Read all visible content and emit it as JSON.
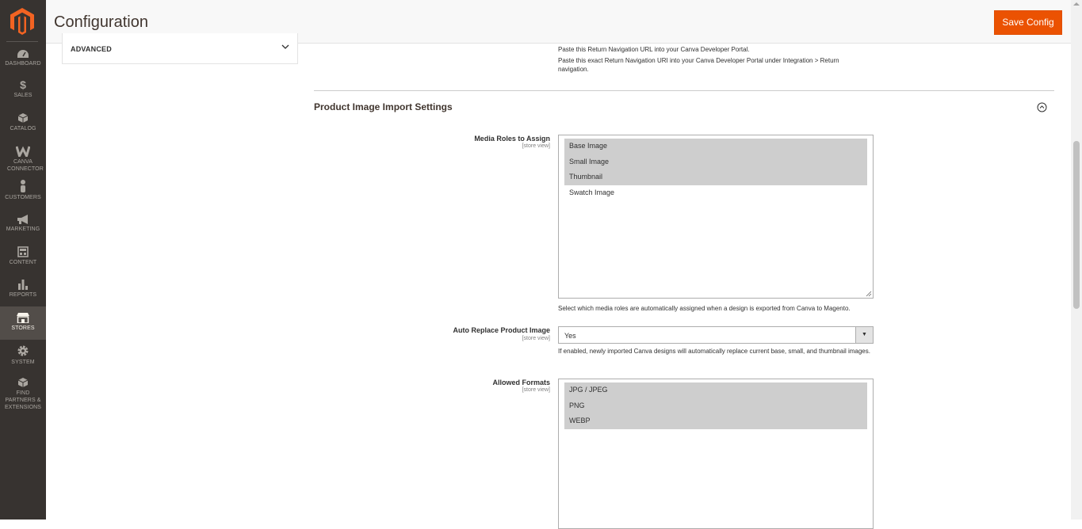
{
  "header": {
    "title": "Configuration",
    "save_label": "Save Config"
  },
  "sidebar": {
    "items": [
      {
        "label": "DASHBOARD",
        "icon": "dashboard-icon"
      },
      {
        "label": "SALES",
        "icon": "dollar-icon"
      },
      {
        "label": "CATALOG",
        "icon": "cube-icon"
      },
      {
        "label": "CANVA CONNECTOR",
        "icon": "canva-w-icon"
      },
      {
        "label": "CUSTOMERS",
        "icon": "person-icon"
      },
      {
        "label": "MARKETING",
        "icon": "megaphone-icon"
      },
      {
        "label": "CONTENT",
        "icon": "layout-icon"
      },
      {
        "label": "REPORTS",
        "icon": "bar-chart-icon"
      },
      {
        "label": "STORES",
        "icon": "store-icon",
        "active": true
      },
      {
        "label": "SYSTEM",
        "icon": "gear-icon"
      },
      {
        "label": "FIND PARTNERS & EXTENSIONS",
        "icon": "box-icon"
      }
    ]
  },
  "left_panel": {
    "advanced_label": "ADVANCED"
  },
  "notes": {
    "return_nav_1": "Paste this Return Navigation URL into your Canva Developer Portal.",
    "return_nav_2": "Paste this exact Return Navigation URI into your Canva Developer Portal under Integration > Return navigation."
  },
  "section": {
    "title": "Product Image Import Settings"
  },
  "fields": {
    "media_roles": {
      "label": "Media Roles to Assign",
      "scope": "[store view]",
      "options": [
        {
          "text": "Base Image",
          "selected": true
        },
        {
          "text": "Small Image",
          "selected": true
        },
        {
          "text": "Thumbnail",
          "selected": true
        },
        {
          "text": "Swatch Image",
          "selected": false
        }
      ],
      "note": "Select which media roles are automatically assigned when a design is exported from Canva to Magento."
    },
    "auto_replace": {
      "label": "Auto Replace Product Image",
      "scope": "[store view]",
      "value": "Yes",
      "note": "If enabled, newly imported Canva designs will automatically replace current base, small, and thumbnail images."
    },
    "allowed_formats": {
      "label": "Allowed Formats",
      "scope": "[store view]",
      "options": [
        {
          "text": "JPG / JPEG",
          "selected": true
        },
        {
          "text": "PNG",
          "selected": true
        },
        {
          "text": "WEBP",
          "selected": true
        }
      ]
    }
  },
  "colors": {
    "accent": "#eb5202",
    "sidebar_bg": "#373330",
    "selected_option": "#cecece"
  }
}
